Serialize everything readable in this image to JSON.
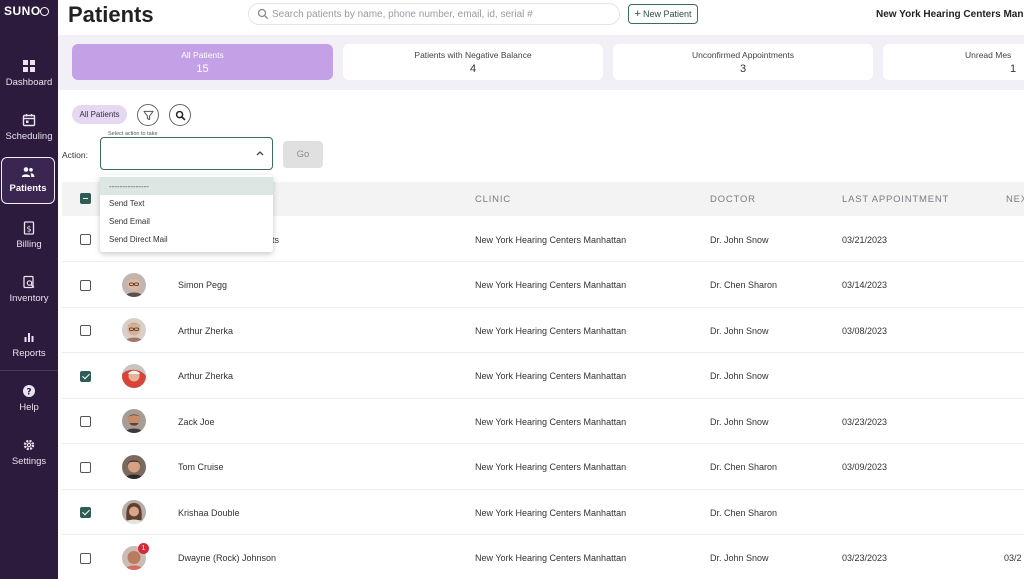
{
  "app": {
    "logo": "SUNO",
    "logo_ring_icon": "o-ring"
  },
  "sidebar": {
    "items": [
      {
        "label": "Dashboard",
        "icon": "grid-icon"
      },
      {
        "label": "Scheduling",
        "icon": "calendar-icon"
      },
      {
        "label": "Patients",
        "icon": "users-icon",
        "active": true
      },
      {
        "label": "Billing",
        "icon": "dollar-doc-icon"
      },
      {
        "label": "Inventory",
        "icon": "inventory-icon"
      },
      {
        "label": "Reports",
        "icon": "bar-chart-icon"
      },
      {
        "label": "Help",
        "icon": "help-icon"
      },
      {
        "label": "Settings",
        "icon": "gear-icon"
      }
    ]
  },
  "header": {
    "title": "Patients",
    "search_placeholder": "Search patients by name, phone number, email, id, serial #",
    "new_patient_label": "New Patient",
    "clinic_name": "New York Hearing Centers Manha"
  },
  "stats": [
    {
      "label": "All Patients",
      "value": "15",
      "active": true
    },
    {
      "label": "Patients with Negative Balance",
      "value": "4"
    },
    {
      "label": "Unconfirmed Appointments",
      "value": "3"
    },
    {
      "label": "Unread Mes",
      "value": "1"
    }
  ],
  "filters": {
    "chip_label": "All Patients"
  },
  "action": {
    "label": "Action:",
    "select_legend": "Select action to take",
    "selected_value": "",
    "go_label": "Go",
    "options": [
      "---------------",
      "Send Text",
      "Send Email",
      "Send Direct Mail"
    ]
  },
  "table": {
    "columns": [
      "CLINIC",
      "DOCTOR",
      "LAST APPOINTMENT",
      "NEX"
    ],
    "rows": [
      {
        "name": "ts",
        "clinic": "New York Hearing Centers Manhattan",
        "doctor": "Dr. John Snow",
        "last_appointment": "03/21/2023",
        "next": "",
        "checked": false
      },
      {
        "name": "Simon Pegg",
        "clinic": "New York Hearing Centers Manhattan",
        "doctor": "Dr. Chen Sharon",
        "last_appointment": "03/14/2023",
        "next": "",
        "checked": false
      },
      {
        "name": "Arthur Zherka",
        "clinic": "New York Hearing Centers Manhattan",
        "doctor": "Dr. John Snow",
        "last_appointment": "03/08/2023",
        "next": "",
        "checked": false
      },
      {
        "name": "Arthur Zherka",
        "clinic": "New York Hearing Centers Manhattan",
        "doctor": "Dr. John Snow",
        "last_appointment": "",
        "next": "",
        "checked": true
      },
      {
        "name": "Zack Joe",
        "clinic": "New York Hearing Centers Manhattan",
        "doctor": "Dr. John Snow",
        "last_appointment": "03/23/2023",
        "next": "",
        "checked": false
      },
      {
        "name": "Tom Cruise",
        "clinic": "New York Hearing Centers Manhattan",
        "doctor": "Dr. Chen Sharon",
        "last_appointment": "03/09/2023",
        "next": "",
        "checked": false
      },
      {
        "name": "Krishaa Double",
        "clinic": "New York Hearing Centers Manhattan",
        "doctor": "Dr. Chen Sharon",
        "last_appointment": "",
        "next": "",
        "checked": true
      },
      {
        "name": "Dwayne (Rock) Johnson",
        "clinic": "New York Hearing Centers Manhattan",
        "doctor": "Dr. John Snow",
        "last_appointment": "03/23/2023",
        "next": "03/2",
        "checked": false,
        "badge": "1"
      }
    ]
  },
  "colors": {
    "sidebar_bg": "#2d1b3d",
    "accent_purple": "#c4a1e6",
    "accent_green": "#2f5d55"
  }
}
